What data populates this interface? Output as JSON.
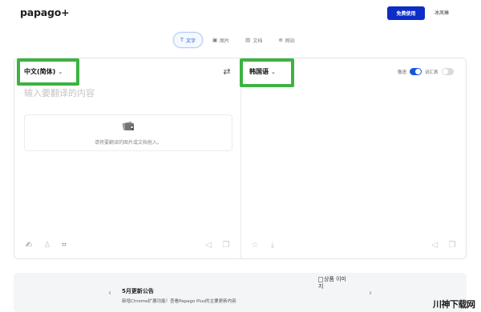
{
  "header": {
    "logo_text": "papago",
    "logo_plus": "+",
    "free_button_label": "免费使用",
    "user_name": "冰凤琳"
  },
  "tabs": [
    {
      "icon": "T",
      "label": "文字",
      "active": true
    },
    {
      "icon": "▣",
      "label": "图片",
      "active": false
    },
    {
      "icon": "▤",
      "label": "文档",
      "active": false
    },
    {
      "icon": "⊕",
      "label": "网站",
      "active": false
    }
  ],
  "translator": {
    "source_language": "中文(简体)",
    "target_language": "韩国语",
    "placeholder": "输入要翻译的内容",
    "dropzone_text": "请将要翻译的图片或文档拖入。",
    "toggle_1_label": "敬语",
    "toggle_1_on": true,
    "toggle_2_label": "词汇表",
    "toggle_2_on": false
  },
  "announcement": {
    "title": "5月更新公告",
    "body": "新增Chrome扩展功能！查看Papago Plus的主要更新内容",
    "image_alt_line1": "상품 이미",
    "image_alt_line2": "지"
  },
  "watermark": "川神下载网",
  "colors": {
    "accent": "#0c2dc7",
    "highlight": "#3db342",
    "tab_active": "#1859d6"
  }
}
